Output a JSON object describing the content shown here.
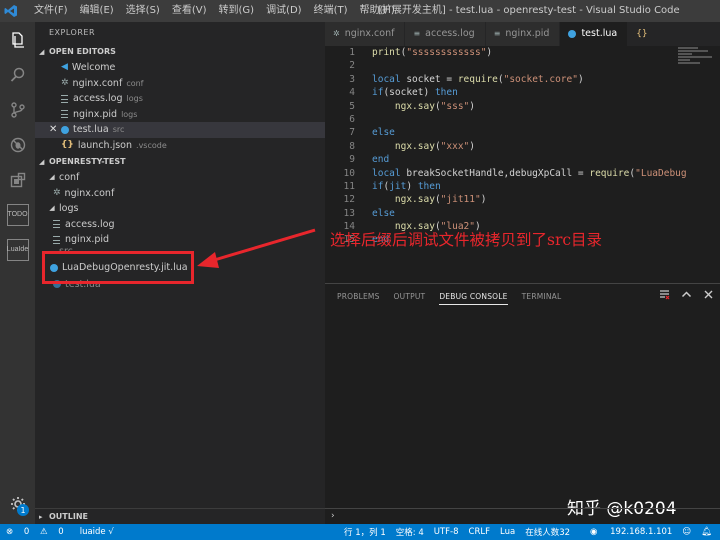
{
  "titlebar": {
    "menu": [
      "文件(F)",
      "编辑(E)",
      "选择(S)",
      "查看(V)",
      "转到(G)",
      "调试(D)",
      "终端(T)",
      "帮助(H)"
    ],
    "window_title": "[扩展开发主机] - test.lua - openresty-test - Visual Studio Code"
  },
  "activity": {
    "todo_label": "TODO",
    "lua_label1": "Lua",
    "lua_label2": "Ide",
    "gear_badge": "1"
  },
  "sidebar": {
    "title": "EXPLORER",
    "open_editors_header": "OPEN EDITORS",
    "open_editors": [
      {
        "name": "Welcome",
        "desc": ""
      },
      {
        "name": "nginx.conf",
        "desc": "conf"
      },
      {
        "name": "access.log",
        "desc": "logs"
      },
      {
        "name": "nginx.pid",
        "desc": "logs"
      },
      {
        "name": "test.lua",
        "desc": "src"
      },
      {
        "name": "launch.json",
        "desc": ".vscode"
      }
    ],
    "folder_header": "OPENRESTY-TEST",
    "tree": [
      {
        "name": "conf"
      },
      {
        "name": "nginx.conf"
      },
      {
        "name": "logs"
      },
      {
        "name": "access.log"
      },
      {
        "name": "nginx.pid"
      },
      {
        "name": "src"
      },
      {
        "name": "LuaDebugOpenresty.jit.lua"
      },
      {
        "name": "test.lua"
      }
    ],
    "outline_header": "OUTLINE"
  },
  "tabs": [
    {
      "label": "nginx.conf"
    },
    {
      "label": "access.log"
    },
    {
      "label": "nginx.pid"
    },
    {
      "label": "test.lua"
    }
  ],
  "tab_actions": [
    "{}",
    "⧉",
    "···"
  ],
  "editor": {
    "lines": [
      "print(\"ssssssssssss\")",
      "",
      "local socket = require(\"socket.core\")",
      "if(socket) then",
      "    ngx.say(\"sss\")",
      "",
      "else",
      "    ngx.say(\"xxx\")",
      "end",
      "local breakSocketHandle,debugXpCall = require(\"LuaDebug",
      "if(jit) then",
      "    ngx.say(\"jit11\")",
      "else",
      "    ngx.say(\"lua2\")",
      "end"
    ]
  },
  "annotation": "选择后缀后调试文件被拷贝到了src目录",
  "panel": {
    "tabs": [
      "PROBLEMS",
      "OUTPUT",
      "DEBUG CONSOLE",
      "TERMINAL"
    ],
    "active_tab": "DEBUG CONSOLE",
    "repl_prompt": "›"
  },
  "watermark": "知乎 @k0204",
  "statusbar": {
    "errors": "0",
    "warnings": "0",
    "luaide": "luaide √",
    "position": "行 1，列 1",
    "spaces": "空格: 4",
    "encoding": "UTF-8",
    "eol": "CRLF",
    "language": "Lua",
    "online": "在线人数32",
    "ip": "192.168.1.101"
  },
  "colors": {
    "accent": "#007acc",
    "annotation_red": "#e8262c",
    "keyword": "#569cd6",
    "string": "#ce9178"
  }
}
